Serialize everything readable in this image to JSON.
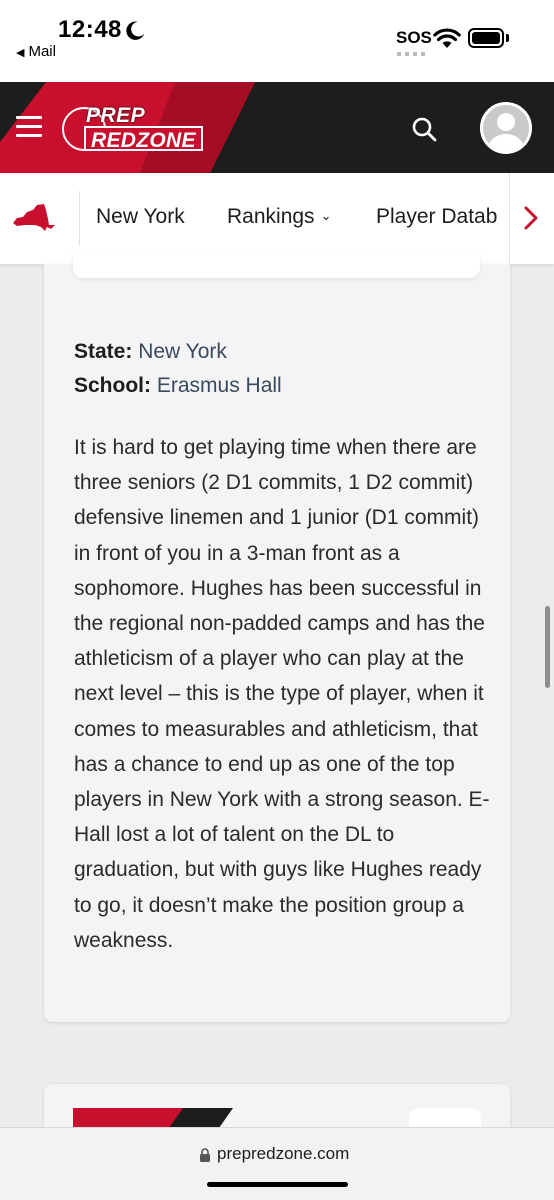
{
  "status_bar": {
    "time": "12:48",
    "back_label": "Mail",
    "sos_label": "SOS",
    "icons": [
      "moon-icon",
      "wifi-icon",
      "battery-icon"
    ]
  },
  "header": {
    "logo_line1": "PREP",
    "logo_line2": "REDZONE",
    "icons": [
      "menu-icon",
      "search-icon",
      "avatar-icon"
    ],
    "colors": {
      "background": "#1d1d1d",
      "accent": "#c8102e"
    }
  },
  "nav": {
    "state_icon": "new-york-state-icon",
    "items": [
      {
        "label": "New York"
      },
      {
        "label": "Rankings",
        "dropdown": true
      },
      {
        "label": "Player Datab"
      }
    ],
    "next_icon": "chevron-right-icon"
  },
  "profile": {
    "state_label": "State:",
    "state_value": "New York",
    "school_label": "School:",
    "school_value": "Erasmus Hall",
    "bio": "It is hard to get playing time when there are three seniors (2 D1 commits, 1 D2 commit) defensive linemen and 1 junior (D1 commit) in front of you in a 3-man front as a sophomore. Hughes has been successful in the regional non-padded camps and has the athleticism of a player who can play at the next level – this is the type of player, when it comes to measurables and athleticism, that has a chance to end up as one of the top players in New York with a strong season. E-Hall lost a lot of talent on the DL to graduation, but with guys like Hughes ready to go, it doesn’t make the position group a weakness."
  },
  "browser": {
    "url": "prepredzone.com",
    "lock_icon": "lock-icon"
  }
}
